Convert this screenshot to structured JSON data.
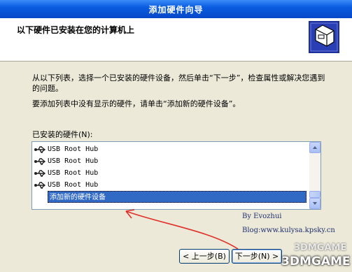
{
  "window": {
    "title": "添加硬件向导"
  },
  "header": {
    "title": "以下硬件已安装在您的计算机上"
  },
  "body": {
    "para1": "从以下列表，选择一个已安装的硬件设备，然后单击“下一步”，检查属性或解决您遇到的问题。",
    "para2": "要添加列表中没有显示的硬件，请单击“添加新的硬件设备”。",
    "list_label": "已安装的硬件(N):"
  },
  "list": {
    "items": [
      {
        "label": "USB Root Hub",
        "icon": "usb-icon"
      },
      {
        "label": "USB Root Hub",
        "icon": "usb-icon"
      },
      {
        "label": "USB Root Hub",
        "icon": "usb-icon"
      },
      {
        "label": "USB Root Hub",
        "icon": "usb-icon"
      },
      {
        "label": "添加新的硬件设备",
        "selected": true
      }
    ]
  },
  "annotation": {
    "by": "By Evozhui",
    "blog": "Blog:www.kulysa.kpsky.cn",
    "arrow_color": "#e0302a"
  },
  "buttons": {
    "back": "< 上一步(B)",
    "next": "下一步(N) >"
  },
  "watermark": {
    "line1": "3DMGAME",
    "line2": "3DMGAME"
  }
}
